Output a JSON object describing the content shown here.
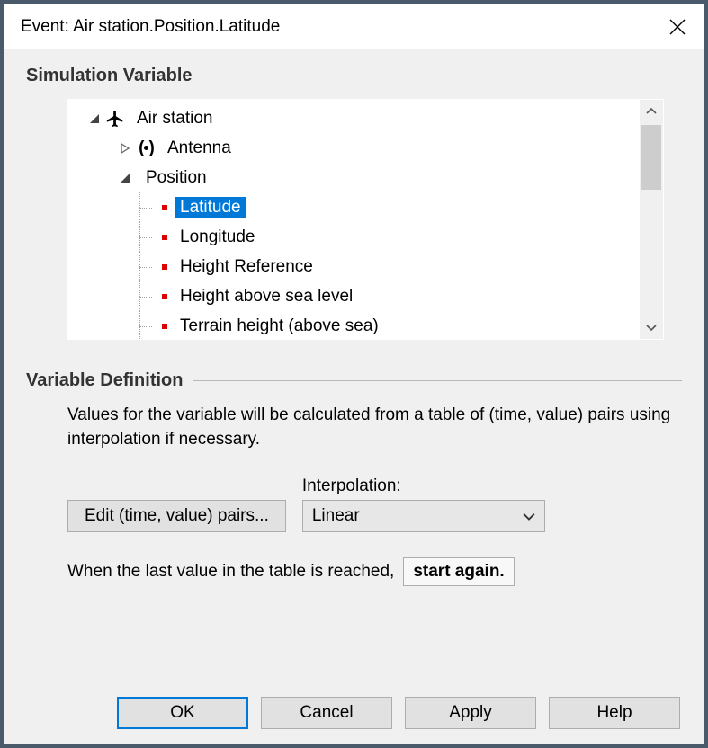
{
  "window": {
    "title": "Event: Air station.Position.Latitude"
  },
  "sections": {
    "sim_var": "Simulation Variable",
    "var_def": "Variable Definition"
  },
  "tree": {
    "root": {
      "label": "Air station"
    },
    "antenna": {
      "label": "Antenna"
    },
    "position": {
      "label": "Position"
    },
    "leaves": {
      "latitude": "Latitude",
      "longitude": "Longitude",
      "height_ref": "Height Reference",
      "height_sea": "Height above sea level",
      "terrain": "Terrain height (above sea)"
    },
    "selected": "latitude"
  },
  "definition": {
    "description": "Values for the variable will be calculated from a table of (time, value) pairs using interpolation if necessary.",
    "edit_button": "Edit (time, value) pairs...",
    "interp_label": "Interpolation:",
    "interp_value": "Linear",
    "last_value_prefix": "When the last value in the table is reached,",
    "last_value_action": "start again."
  },
  "buttons": {
    "ok": "OK",
    "cancel": "Cancel",
    "apply": "Apply",
    "help": "Help"
  }
}
